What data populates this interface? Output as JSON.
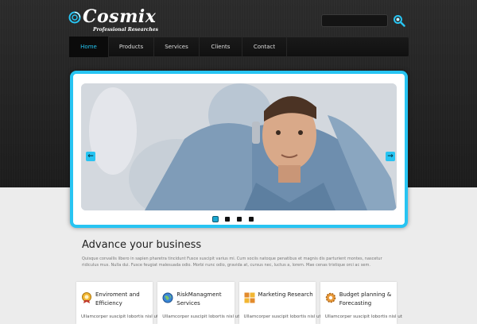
{
  "brand": {
    "name": "Cosmix",
    "tagline": "Professional Researches",
    "accent": "#27c4f2"
  },
  "search": {
    "placeholder": "",
    "icon": "search-icon"
  },
  "nav": {
    "items": [
      {
        "label": "Home",
        "active": true
      },
      {
        "label": "Products"
      },
      {
        "label": "Services"
      },
      {
        "label": "Clients"
      },
      {
        "label": "Contact"
      }
    ]
  },
  "slider": {
    "prev_label": "←",
    "next_label": "→",
    "slides_count": 4,
    "active_index": 0
  },
  "main": {
    "heading": "Advance your business",
    "intro": "Quisque convallis libero in sapien pharetra tincidunt Fusce suscipit varius mi. Cum sociis natoque penatibus et magnis dis parturient montes, nascetur ridiculus mus. Nulla dui. Fusce feugiat malesuada odio. Morbi nunc odio, gravida at, cursus nec, luctus a, lorem. Mae cenas tristique orci ac sem."
  },
  "features": [
    {
      "title": "Enviroment and Efficiency",
      "text": "Ullamcorper suscipit lobortis nisl ut",
      "icon": "award-icon"
    },
    {
      "title": "RiskManagment Services",
      "text": "Ullamcorper suscipit lobortis nisl ut",
      "icon": "globe-icon"
    },
    {
      "title": "Marketing Research",
      "text": "Ullamcorper suscipit lobortis nisl ut",
      "icon": "grid-icon"
    },
    {
      "title": "Budget planning & Forecasting",
      "text": "Ullamcorper suscipit lobortis nisl ut",
      "icon": "gear-icon"
    }
  ]
}
